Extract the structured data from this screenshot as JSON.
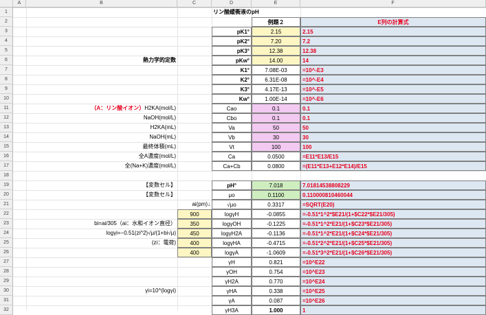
{
  "columns": [
    "A",
    "B",
    "C",
    "D",
    "E",
    "F"
  ],
  "rows": [
    "1",
    "2",
    "3",
    "4",
    "5",
    "6",
    "7",
    "8",
    "9",
    "10",
    "11",
    "12",
    "13",
    "14",
    "15",
    "16",
    "17",
    "18",
    "19",
    "20",
    "21",
    "22",
    "23",
    "24",
    "25",
    "26",
    "27",
    "28",
    "29",
    "30",
    "31",
    "32"
  ],
  "title": "リン酸緩衝液のpH",
  "example_header": "例題２",
  "formula_header": "E列の計算式",
  "thermo_label": "熱力学的定数",
  "thermo": [
    {
      "label": "pK1°",
      "value": "2.15",
      "formula": "2.15"
    },
    {
      "label": "pK2°",
      "value": "7.20",
      "formula": "7.2"
    },
    {
      "label": "pK3°",
      "value": "12.38",
      "formula": "12.38"
    },
    {
      "label": "pKw°",
      "value": "14.00",
      "formula": "14"
    },
    {
      "label": "K1°",
      "value": "7.08E-03",
      "formula": "=10^-E3"
    },
    {
      "label": "K2°",
      "value": "6.31E-08",
      "formula": "=10^-E4"
    },
    {
      "label": "K3°",
      "value": "4.17E-13",
      "formula": "=10^-E5"
    },
    {
      "label": "Kw°",
      "value": "1.00E-14",
      "formula": "=10^-E6"
    }
  ],
  "inputs": [
    {
      "desc_prefix": "（A：リン酸イオン）",
      "desc": "H2KA(mol/L)",
      "label": "Cao",
      "value": "0.1",
      "formula": "0.1"
    },
    {
      "desc": "NaOH(mol/L)",
      "label": "Cbo",
      "value": "0.1",
      "formula": "0.1"
    },
    {
      "desc": "H2KA(mL)",
      "label": "Va",
      "value": "50",
      "formula": "50"
    },
    {
      "desc": "NaOH(mL)",
      "label": "Vb",
      "value": "30",
      "formula": "30"
    },
    {
      "desc": "最終体積(mL)",
      "label": "Vt",
      "value": "100",
      "formula": "100"
    },
    {
      "desc": "全A濃度(mol/L)",
      "label": "Ca",
      "value": "0.0500",
      "formula": "=E11*E13/E15"
    },
    {
      "desc": "全(Na+K)濃度(mol/L)",
      "label": "Ca+Cb",
      "value": "0.0800",
      "formula": "=(E11*E13+E12*E14)/E15"
    }
  ],
  "vars": [
    {
      "desc": "【変数セル】",
      "label": "pH°",
      "value": "7.018",
      "formula": "7.01814538808229"
    },
    {
      "desc": "【変数セル】",
      "label": "μo",
      "value": "0.1100",
      "formula": "0.110000810460044"
    },
    {
      "label": "√μo",
      "value": "0.3317",
      "formula": "=SQRT(E20)"
    }
  ],
  "ai_header": "ai(pm)↓",
  "ion_desc": [
    "bi=ai/305（ai：水和イオン直径）",
    "logγi=−0.51(zi^2)√μ/(1+bi√μ)",
    "(zi：電荷)"
  ],
  "ions": [
    {
      "ai": "900",
      "label": "logγH",
      "value": "-0.0855",
      "formula": "=-0.51*1^2*$E21/(1+$C22*$E21/305)"
    },
    {
      "ai": "350",
      "label": "logγOH",
      "value": "-0.1225",
      "formula": "=-0.51*1^2*E21/(1+$C23*$E21/305)"
    },
    {
      "ai": "450",
      "label": "logγH2A",
      "value": "-0.1136",
      "formula": "=-0.51*1^2*E21/(1+$C24*$E21/305)"
    },
    {
      "ai": "400",
      "label": "logγHA",
      "value": "-0.4715",
      "formula": "=-0.51*2^2*E21/(1+$C25*$E21/305)"
    },
    {
      "ai": "400",
      "label": "logγA",
      "value": "-1.0609",
      "formula": "=-0.51*3^2*E21/(1+$C26*$E21/305)"
    }
  ],
  "gamma_label": "γi=10^(logγi)",
  "gammas": [
    {
      "label": "γH",
      "value": "0.821",
      "formula": "=10^E22"
    },
    {
      "label": "γOH",
      "value": "0.754",
      "formula": "=10^E23"
    },
    {
      "label": "γH2A",
      "value": "0.770",
      "formula": "=10^E24"
    },
    {
      "label": "γHA",
      "value": "0.338",
      "formula": "=10^E25"
    },
    {
      "label": "γA",
      "value": "0.087",
      "formula": "=10^E26"
    },
    {
      "label": "γH3A",
      "value": "1.000",
      "formula": "1"
    }
  ]
}
